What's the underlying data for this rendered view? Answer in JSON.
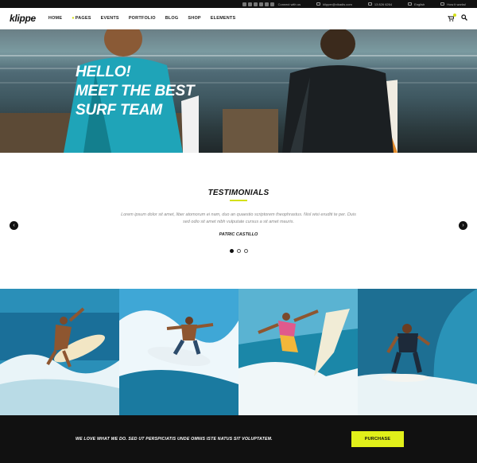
{
  "topbar": {
    "connect_label": "Connect with us",
    "email": "klipper@vikadis.com",
    "phone": "13 826 6264",
    "language": "English",
    "how_it_works": "How it works!"
  },
  "nav": {
    "logo": "klippe",
    "items": [
      "HOME",
      "PAGES",
      "EVENTS",
      "PORTFOLIO",
      "BLOG",
      "SHOP",
      "ELEMENTS"
    ]
  },
  "hero": {
    "line1": "HELLO!",
    "line2": "MEET THE BEST",
    "line3": "SURF TEAM"
  },
  "testimonials": {
    "title": "TESTIMONIALS",
    "quote": "Lorem ipsum dolor sit amet, liber atomorum ei nam, duo an quaestio scriptorem theophrastus. Nisl wisi eruditi te per. Duis sed odio sit amet nibh vulputate cursus a sit amet mauris.",
    "author": "PATRIC CASTILLO",
    "prev_icon": "chevron-left-icon",
    "next_icon": "chevron-right-icon",
    "active_dot": 1,
    "dot_count": 3
  },
  "gallery": {
    "tiles": [
      "surfer-1",
      "surfer-2",
      "surfer-3",
      "surfer-4"
    ]
  },
  "footer": {
    "text": "WE LOVE WHAT WE DO. SED UT PERSPICIATIS UNDE OMNIS ISTE NATUS SIT VOLUPTATEM.",
    "button": "PURCHASE"
  },
  "colors": {
    "accent": "#e1f01a",
    "dark": "#111111"
  }
}
